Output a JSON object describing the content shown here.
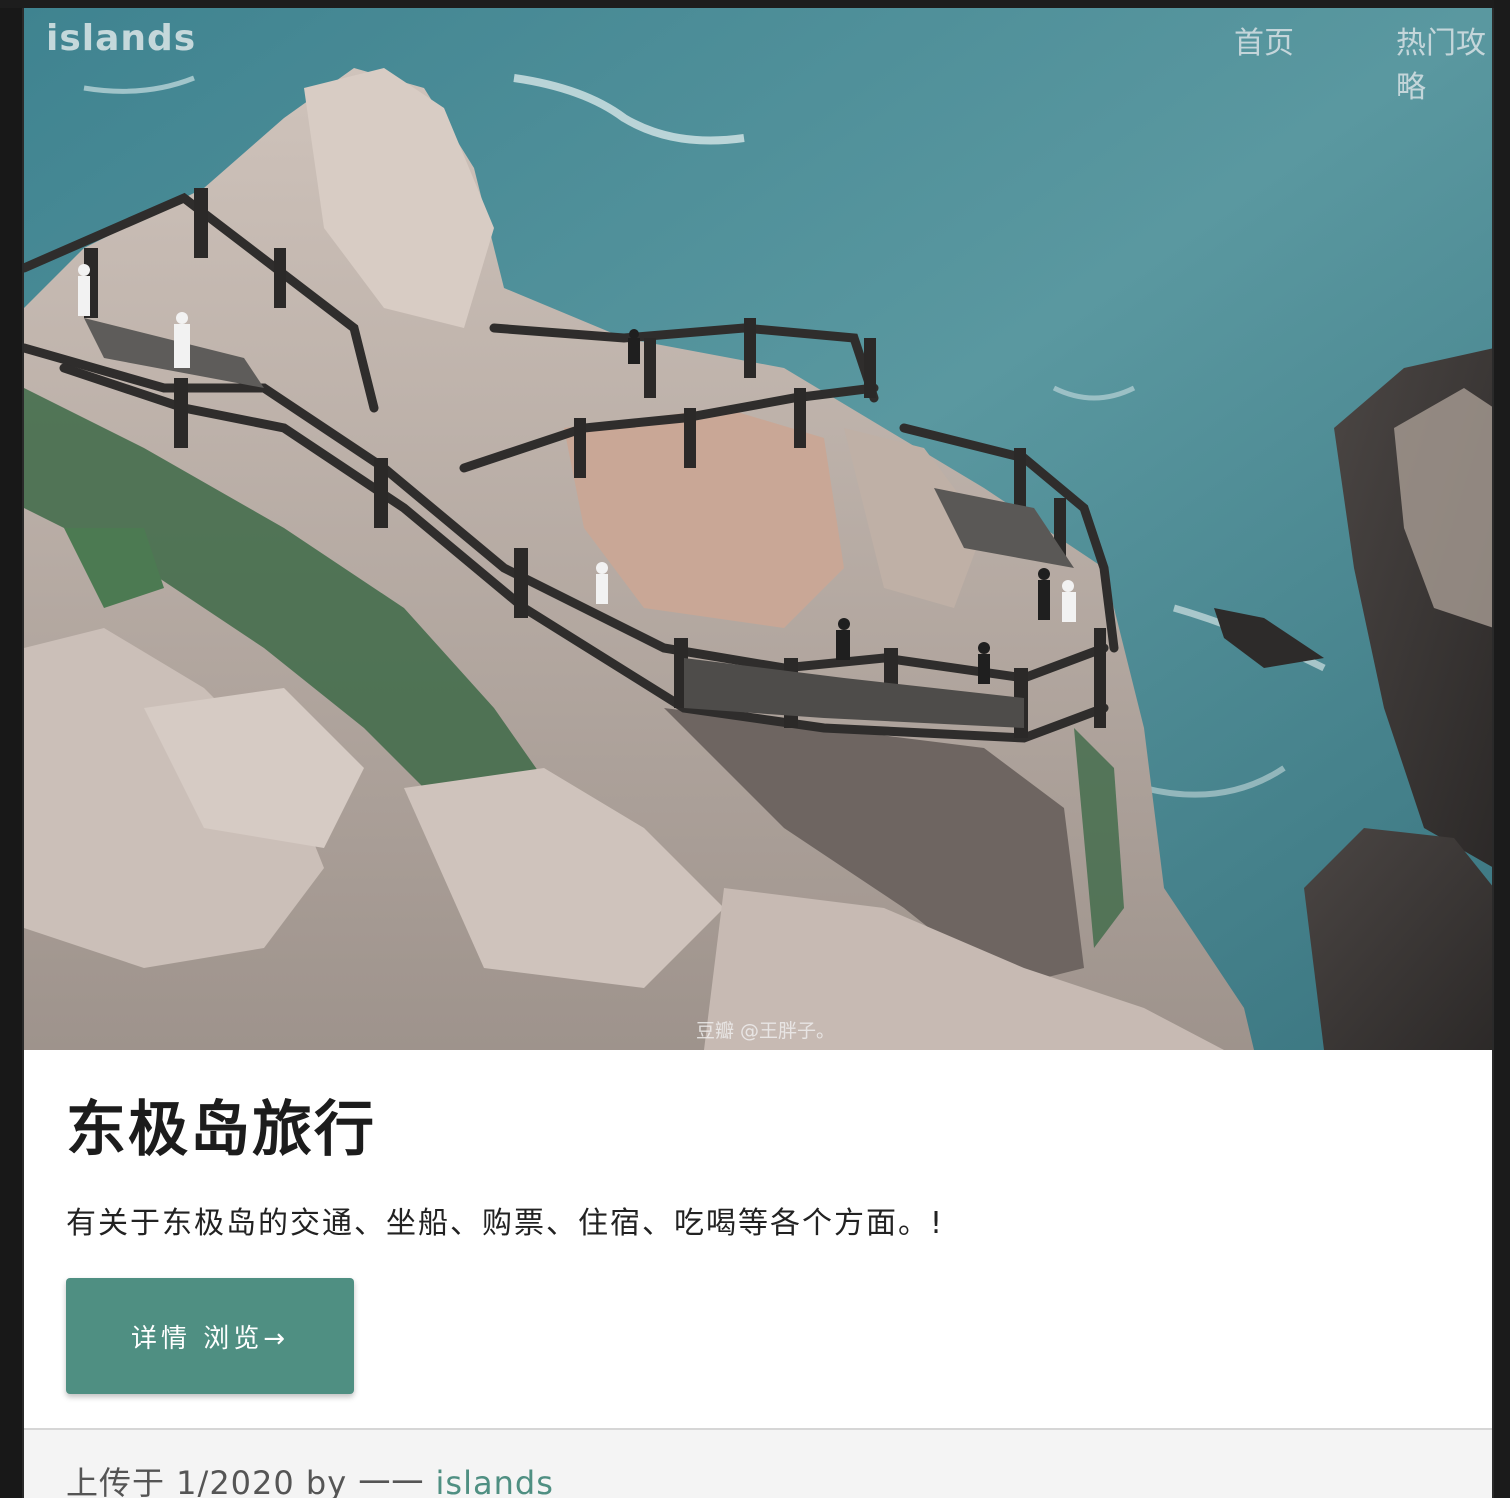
{
  "header": {
    "brand": "islands",
    "nav": [
      {
        "label": "首页"
      },
      {
        "label": "热门攻略"
      }
    ]
  },
  "hero": {
    "image_alt": "东极岛 coastal cliff walkway",
    "watermark": "豆瓣  @王胖子。"
  },
  "article": {
    "title": "东极岛旅行",
    "description": "有关于东极岛的交通、坐船、购票、住宿、吃喝等各个方面。!",
    "button_label": "详情 浏览→"
  },
  "footer": {
    "prefix": "上传于 1/2020 by 一一 ",
    "author": "islands"
  },
  "colors": {
    "accent": "#4f8f82",
    "sea": "#4f8f98",
    "rock": "#b8aca4"
  }
}
